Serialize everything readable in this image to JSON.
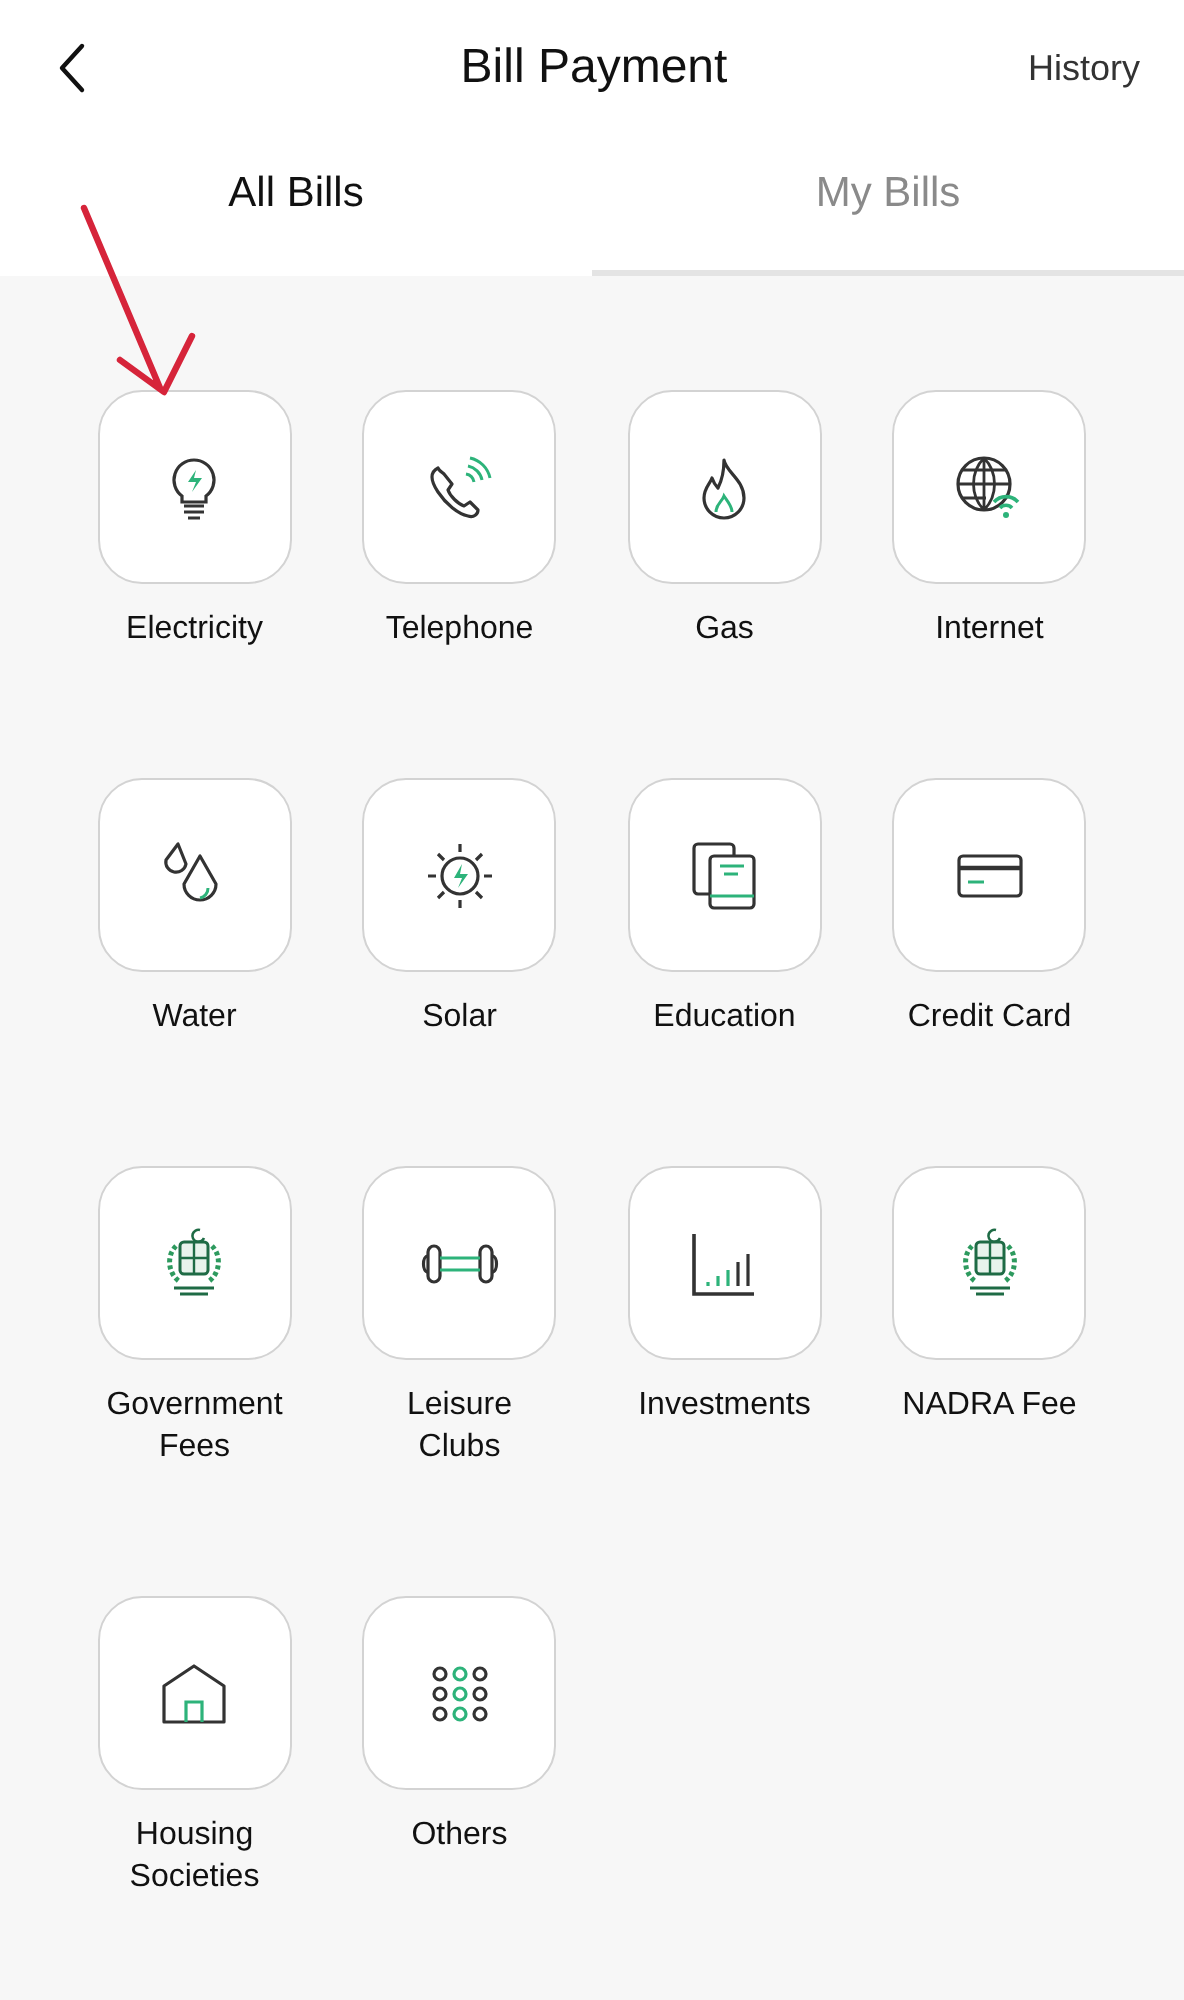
{
  "header": {
    "title": "Bill Payment",
    "action": "History"
  },
  "tabs": [
    {
      "label": "All Bills",
      "selected": true
    },
    {
      "label": "My Bills",
      "selected": false
    }
  ],
  "categories": [
    {
      "kind": "bulb",
      "label": "Electricity"
    },
    {
      "kind": "phone",
      "label": "Telephone"
    },
    {
      "kind": "flame",
      "label": "Gas"
    },
    {
      "kind": "globe",
      "label": "Internet"
    },
    {
      "kind": "drops",
      "label": "Water"
    },
    {
      "kind": "sun",
      "label": "Solar"
    },
    {
      "kind": "books",
      "label": "Education"
    },
    {
      "kind": "card",
      "label": "Credit Card"
    },
    {
      "kind": "emblem",
      "label": "Government Fees"
    },
    {
      "kind": "dumbbell",
      "label": "Leisure Clubs"
    },
    {
      "kind": "chart",
      "label": "Investments"
    },
    {
      "kind": "emblem",
      "label": "NADRA Fee"
    },
    {
      "kind": "house",
      "label": "Housing Societies"
    },
    {
      "kind": "dots",
      "label": "Others"
    }
  ]
}
